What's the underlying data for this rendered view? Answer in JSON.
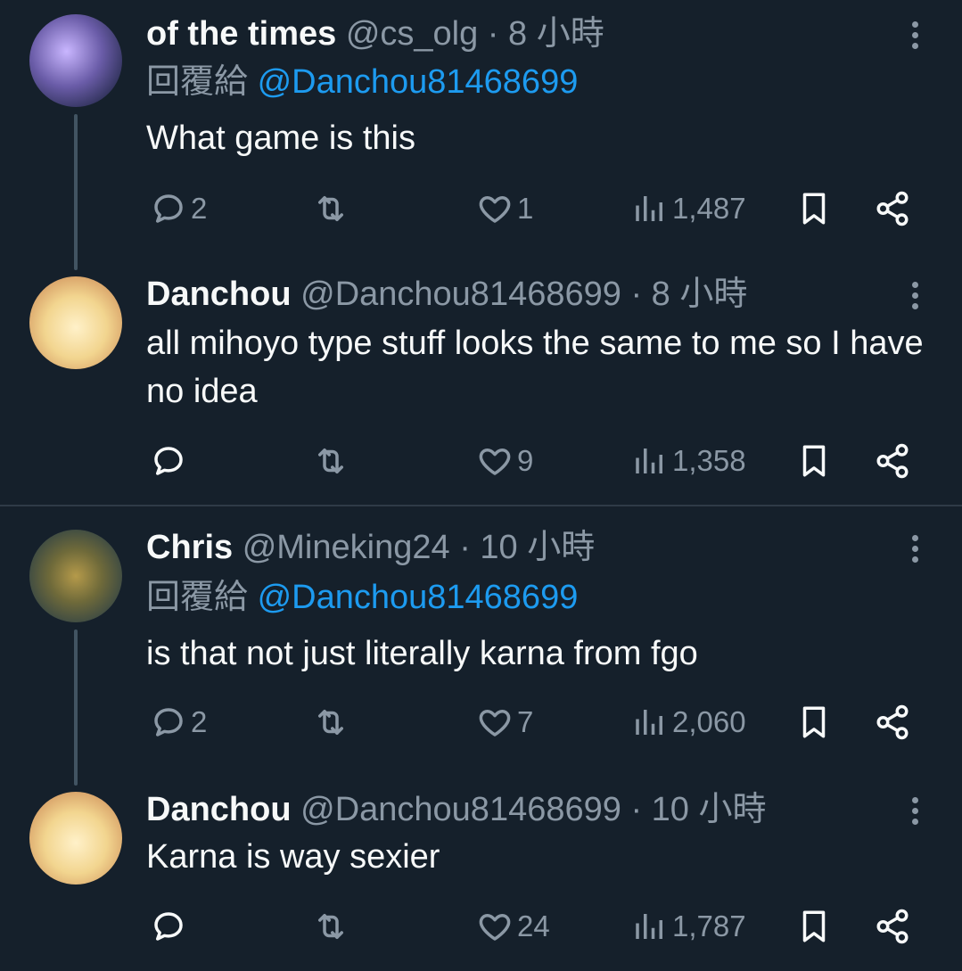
{
  "tweets": [
    {
      "name": "of the times",
      "handle": "@cs_olg",
      "time": "· 8 小時",
      "reply_label": "回覆給",
      "reply_mention": "@Danchou81468699",
      "text": "What game is this",
      "stats": {
        "replies": "2",
        "retweets": "",
        "likes": "1",
        "views": "1,487"
      }
    },
    {
      "name": "Danchou",
      "handle": "@Danchou81468699",
      "time": "· 8 小時",
      "text": "all mihoyo type stuff looks the same to me so I have no idea",
      "stats": {
        "replies": "",
        "retweets": "",
        "likes": "9",
        "views": "1,358"
      }
    },
    {
      "name": "Chris",
      "handle": "@Mineking24",
      "time": "· 10 小時",
      "reply_label": "回覆給",
      "reply_mention": "@Danchou81468699",
      "text": "is that not just literally karna from fgo",
      "stats": {
        "replies": "2",
        "retweets": "",
        "likes": "7",
        "views": "2,060"
      }
    },
    {
      "name": "Danchou",
      "handle": "@Danchou81468699",
      "time": "· 10 小時",
      "text": "Karna is way sexier",
      "stats": {
        "replies": "",
        "retweets": "",
        "likes": "24",
        "views": "1,787"
      }
    }
  ],
  "icons": {
    "reply": "reply-icon",
    "retweet": "retweet-icon",
    "like": "heart-icon",
    "views": "views-icon",
    "bookmark": "bookmark-icon",
    "share": "share-icon",
    "more": "more-icon"
  },
  "colors": {
    "background": "#15202b",
    "text": "#f7f9f9",
    "muted": "#8b98a5",
    "link": "#1d9bf0"
  }
}
